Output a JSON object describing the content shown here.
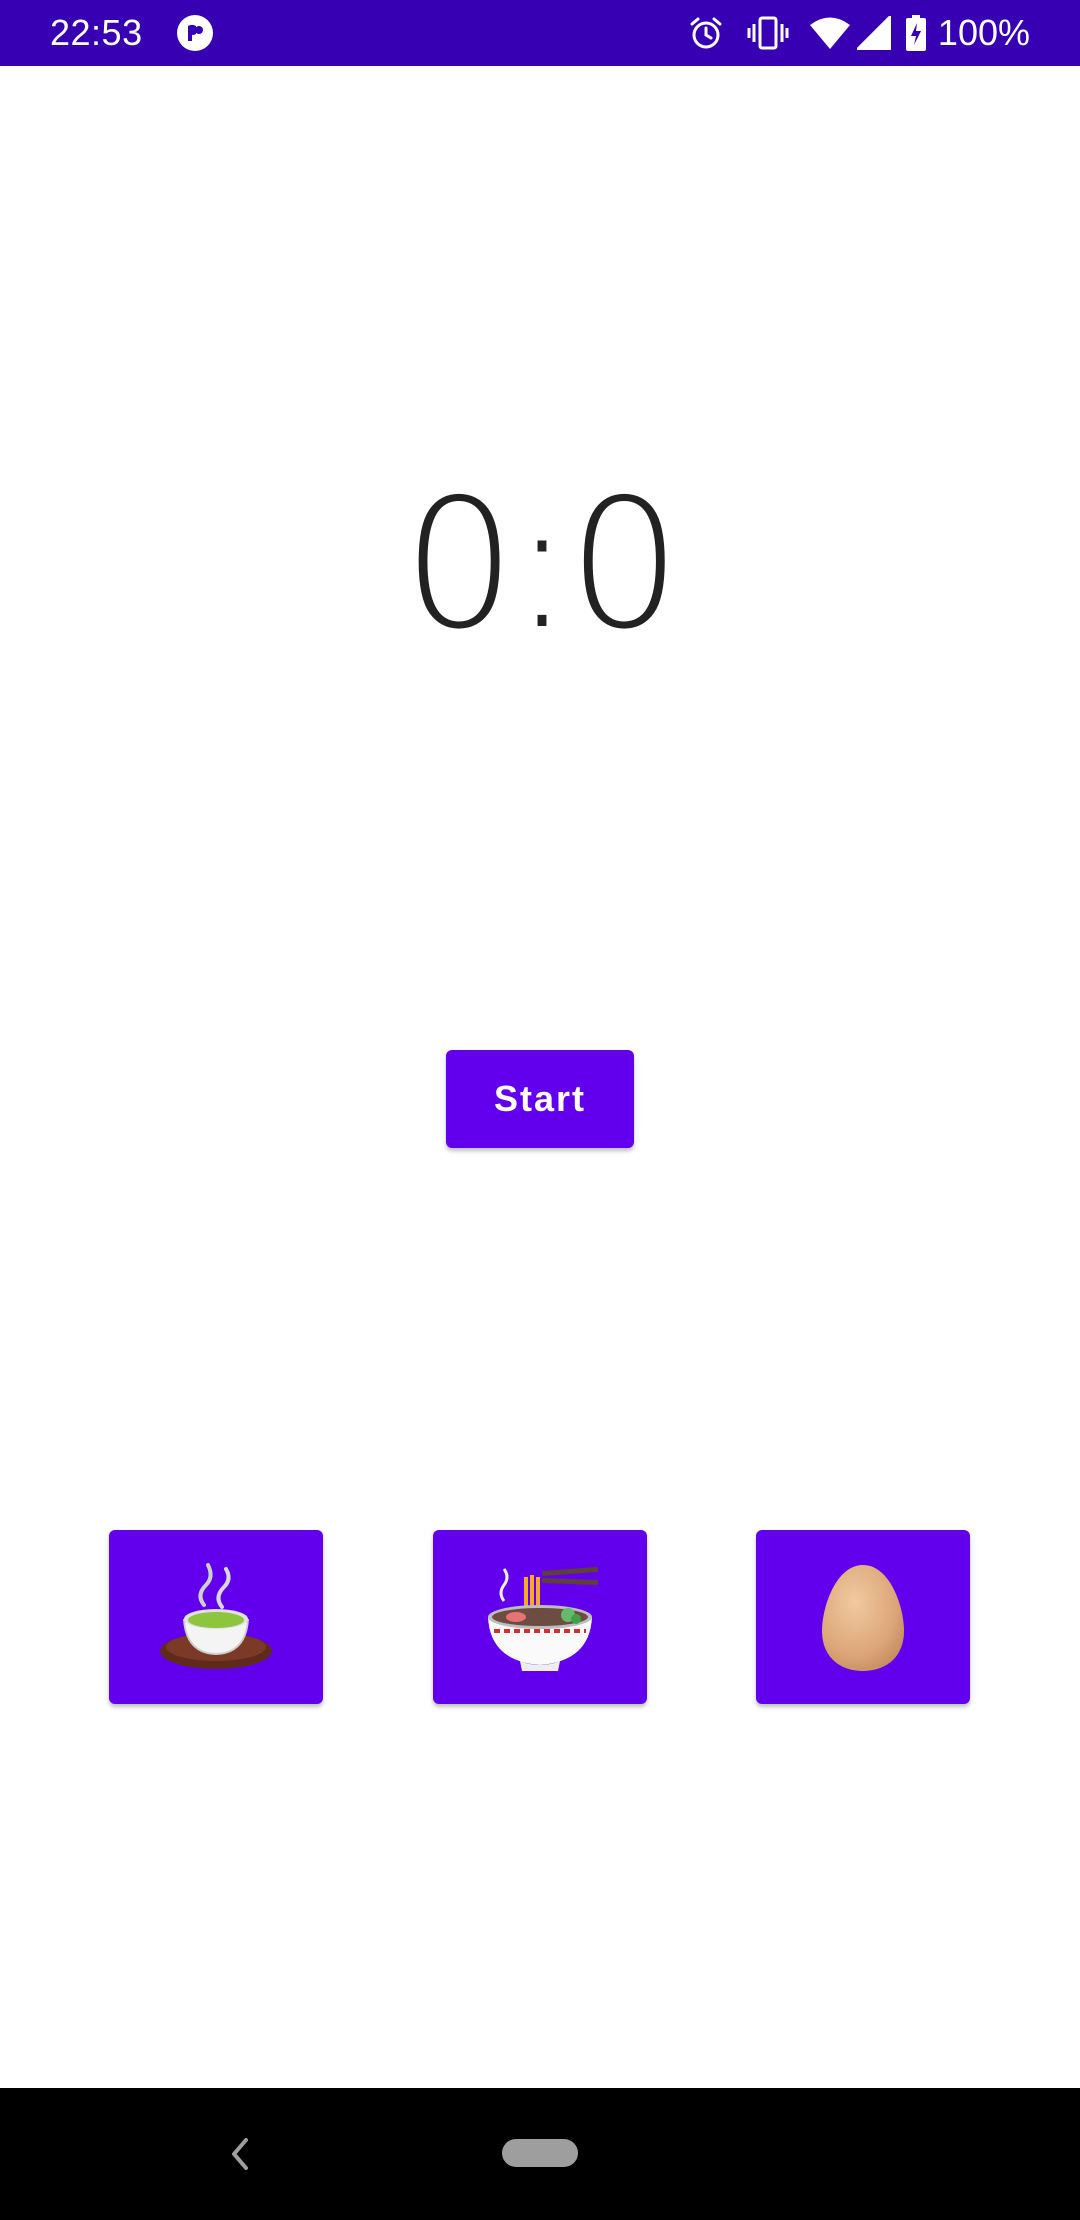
{
  "status_bar": {
    "time": "22:53",
    "battery_text": "100%",
    "background_color": "#3700b3",
    "icons": [
      "app-icon",
      "alarm-icon",
      "vibrate-icon",
      "wifi-icon",
      "signal-icon",
      "battery-charging-icon"
    ]
  },
  "timer": {
    "display": "0:0"
  },
  "start_button": {
    "label": "Start",
    "color": "#6200ee"
  },
  "presets": [
    {
      "icon": "green-tea-icon"
    },
    {
      "icon": "noodle-bowl-icon"
    },
    {
      "icon": "egg-icon"
    }
  ],
  "nav_bar": {
    "icons": [
      "back-icon",
      "home-pill"
    ]
  }
}
